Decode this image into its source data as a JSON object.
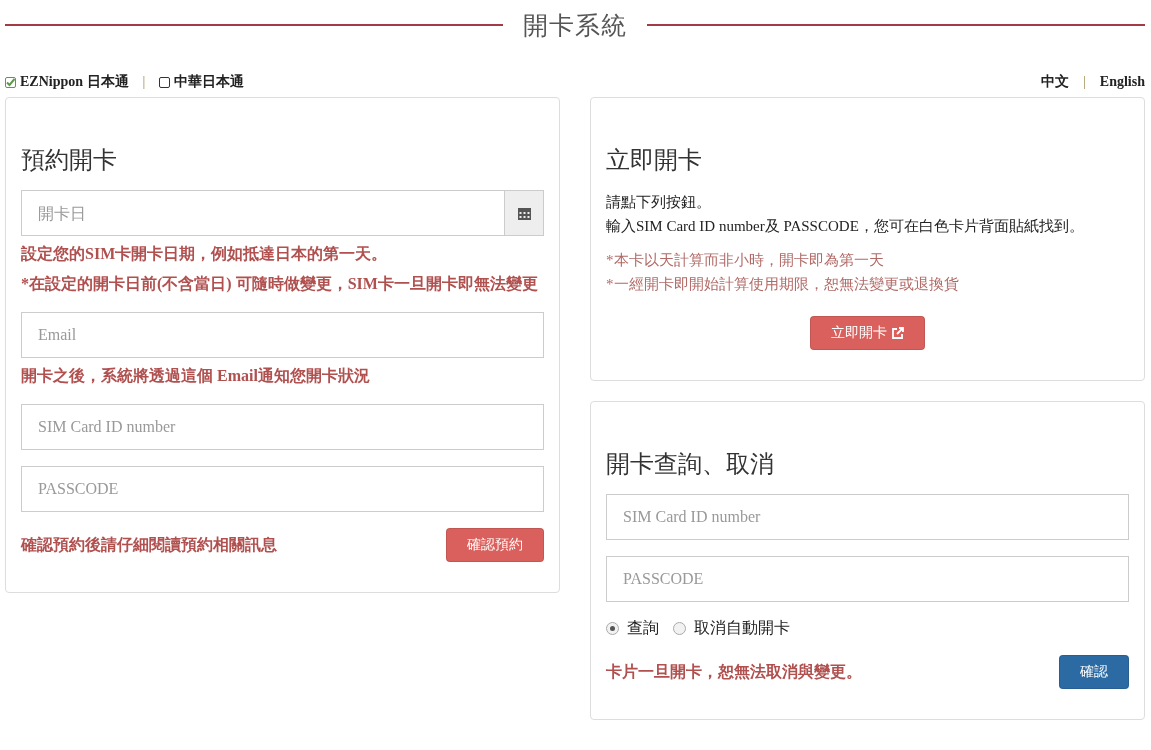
{
  "page_title": "開卡系統",
  "brands": [
    {
      "label": "EZNippon 日本通",
      "checked": true
    },
    {
      "label": "中華日本通",
      "checked": false
    }
  ],
  "brand_separator": "|",
  "languages": [
    {
      "label": "中文"
    },
    {
      "label": "English"
    }
  ],
  "language_separator": "|",
  "reserve": {
    "title": "預約開卡",
    "items": [
      {
        "kind": "date",
        "placeholder": "開卡日"
      },
      {
        "kind": "note",
        "text": "設定您的SIM卡開卡日期，例如抵達日本的第一天。"
      },
      {
        "kind": "note",
        "text": "*在設定的開卡日前(不含當日) 可隨時做變更，SIM卡一旦開卡即無法變更"
      },
      {
        "kind": "field",
        "placeholder": "Email"
      },
      {
        "kind": "note",
        "text": "開卡之後，系統將透過這個 Email通知您開卡狀況"
      },
      {
        "kind": "field",
        "placeholder": "SIM Card ID number"
      },
      {
        "kind": "field",
        "placeholder": "PASSCODE"
      }
    ],
    "footer_note": "確認預約後請仔細閱讀預約相關訊息",
    "button": "確認預約"
  },
  "instant": {
    "title": "立即開卡",
    "instructions": [
      "請點下列按鈕。",
      "輸入SIM Card ID number及 PASSCODE，您可在白色卡片背面貼紙找到。"
    ],
    "warnings": [
      "*本卡以天計算而非小時，開卡即為第一天",
      "*一經開卡即開始計算使用期限，恕無法變更或退換貨"
    ],
    "button": "立即開卡"
  },
  "query": {
    "title": "開卡查詢、取消",
    "fields": [
      {
        "placeholder": "SIM Card ID number"
      },
      {
        "placeholder": "PASSCODE"
      }
    ],
    "options": [
      {
        "label": "查詢",
        "selected": true
      },
      {
        "label": "取消自動開卡",
        "selected": false
      }
    ],
    "note": "卡片一旦開卡，恕無法取消與變更。",
    "button": "確認"
  }
}
